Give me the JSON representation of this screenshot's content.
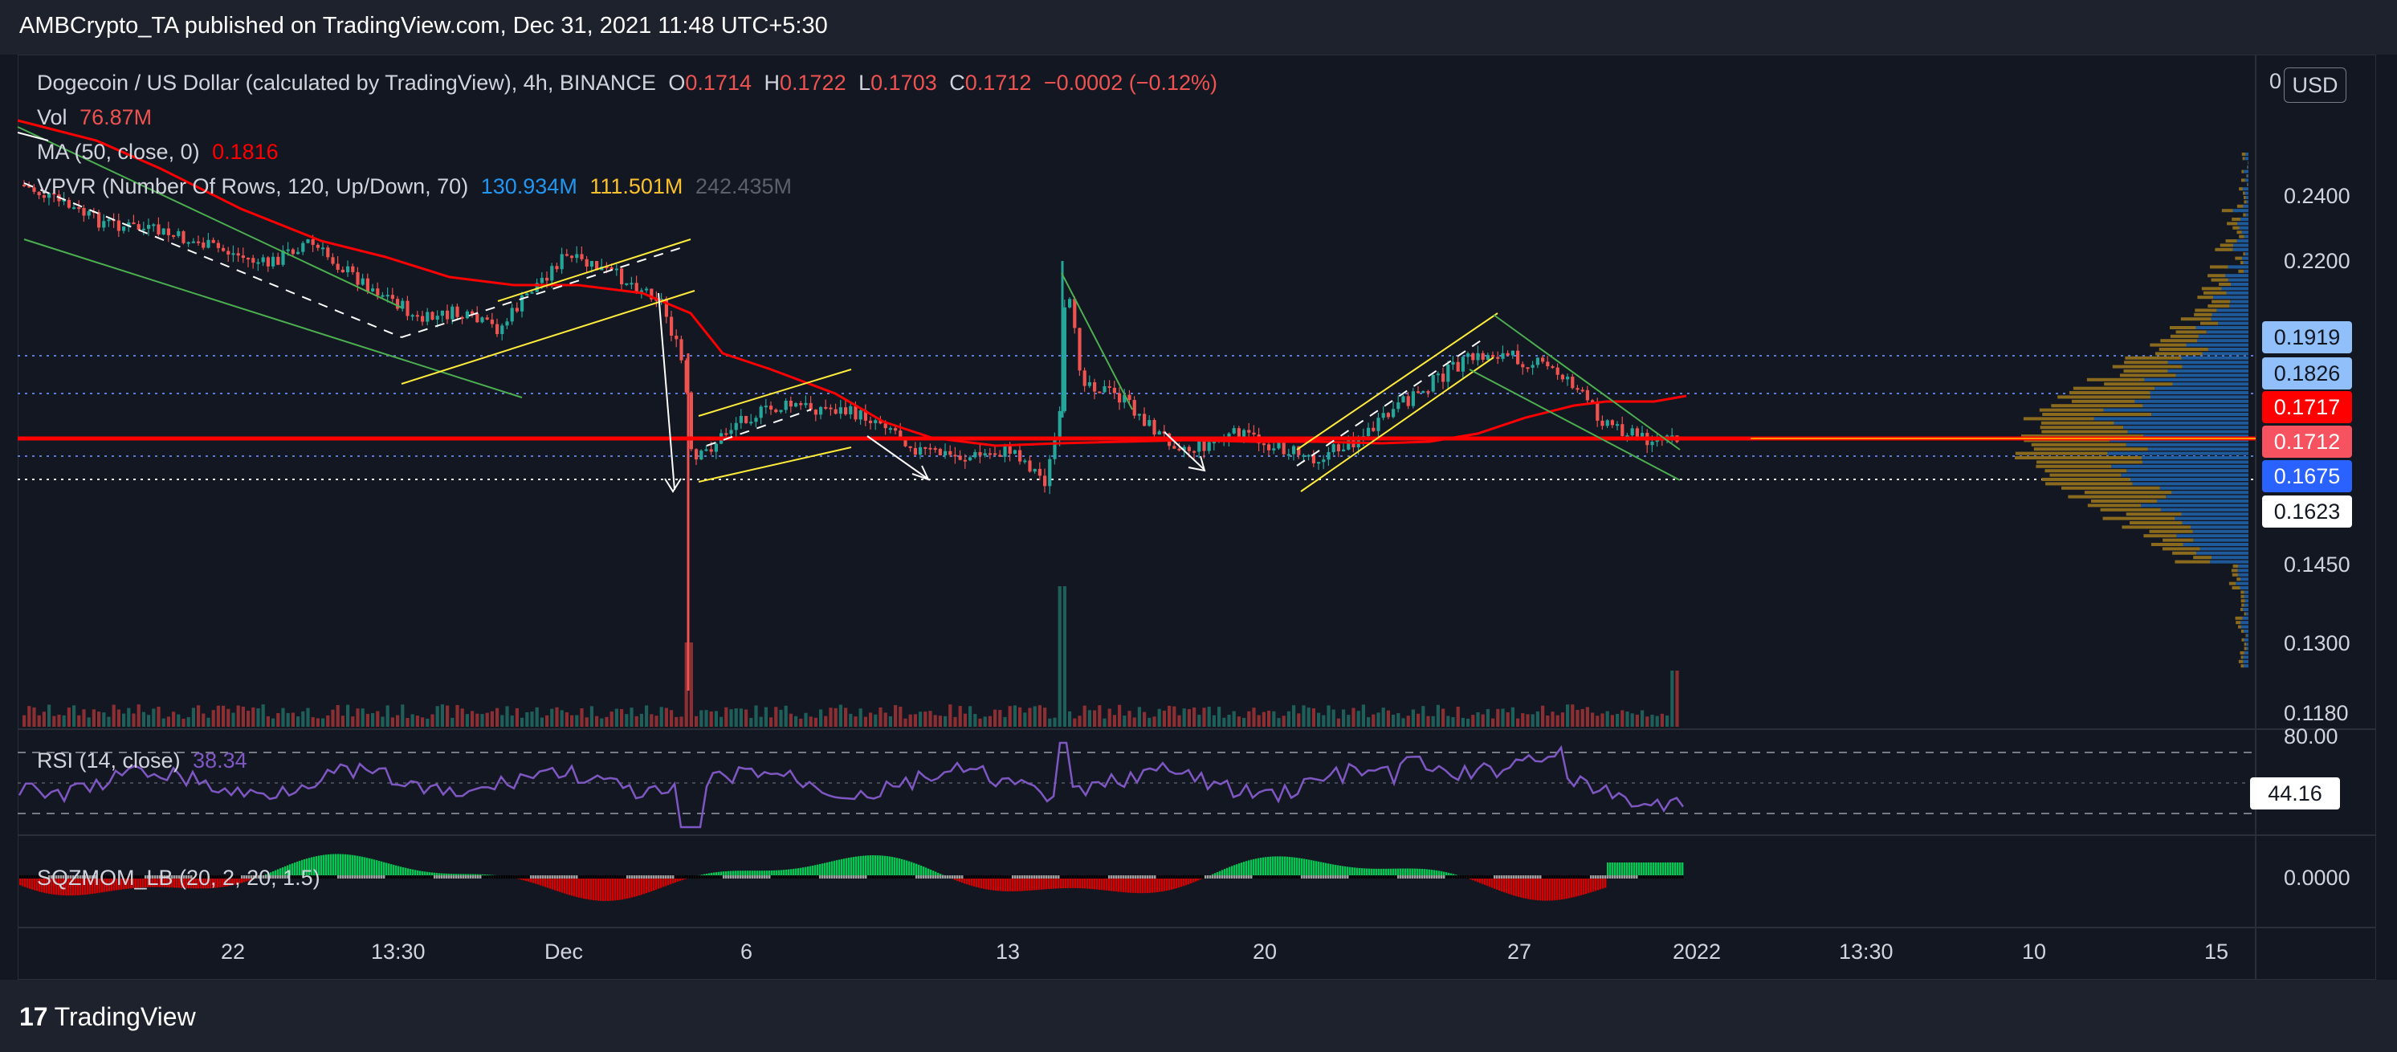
{
  "header": {
    "published": "AMBCrypto_TA published on TradingView.com, Dec 31, 2021 11:48 UTC+5:30"
  },
  "legend": {
    "symbol": "Dogecoin / US Dollar (calculated by TradingView), 4h, BINANCE",
    "o_label": "O",
    "o_val": "0.1714",
    "h_label": "H",
    "h_val": "0.1722",
    "l_label": "L",
    "l_val": "0.1703",
    "c_label": "C",
    "c_val": "0.1712",
    "change": "−0.0002 (−0.12%)",
    "vol_label": "Vol",
    "vol_val": "76.87M",
    "ma_label": "MA (50, close, 0)",
    "ma_val": "0.1816",
    "vpvr_label": "VPVR (Number Of Rows, 120, Up/Down, 70)",
    "vpvr_up": "130.934M",
    "vpvr_down": "111.501M",
    "vpvr_total": "242.435M",
    "rsi_label": "RSI (14, close)",
    "rsi_val": "38.34",
    "sqz_label": "SQZMOM_LB (20, 2, 20, 1.5)"
  },
  "price_scale": {
    "currency": "USD",
    "top": "0",
    "ticks": [
      "0.2400",
      "0.2200",
      "0.1450",
      "0.1300",
      "0.1180"
    ],
    "badges": [
      {
        "text": "0.1919",
        "bg": "#90bff9",
        "fg": "#131722"
      },
      {
        "text": "0.1826",
        "bg": "#90bff9",
        "fg": "#131722"
      },
      {
        "text": "0.1717",
        "bg": "#ff0000",
        "fg": "#ffffff"
      },
      {
        "text": "0.1712",
        "bg": "#f7525f",
        "fg": "#ffffff"
      },
      {
        "text": "0.1675",
        "bg": "#2962ff",
        "fg": "#ffffff"
      },
      {
        "text": "0.1623",
        "bg": "#ffffff",
        "fg": "#131722"
      }
    ],
    "rsi_tick": "80.00",
    "rsi_badge": "44.16",
    "sqz_tick": "0.0000"
  },
  "time_axis": [
    "22",
    "13:30",
    "Dec",
    "6",
    "13",
    "20",
    "27",
    "2022",
    "13:30",
    "10",
    "15"
  ],
  "footer": {
    "brand": "TradingView"
  },
  "colors": {
    "up": "#26a69a",
    "down": "#ef5350",
    "ma": "#ff0000",
    "support": "#ff0000",
    "rsi": "#7e57c2"
  },
  "chart_data": {
    "type": "candlestick",
    "symbol": "DOGE/USD",
    "interval": "4h",
    "support_level": 0.1717,
    "price_range": [
      0.11,
      0.255
    ],
    "rsi_last": 38.34,
    "rsi_levels": [
      80,
      44.16
    ]
  }
}
